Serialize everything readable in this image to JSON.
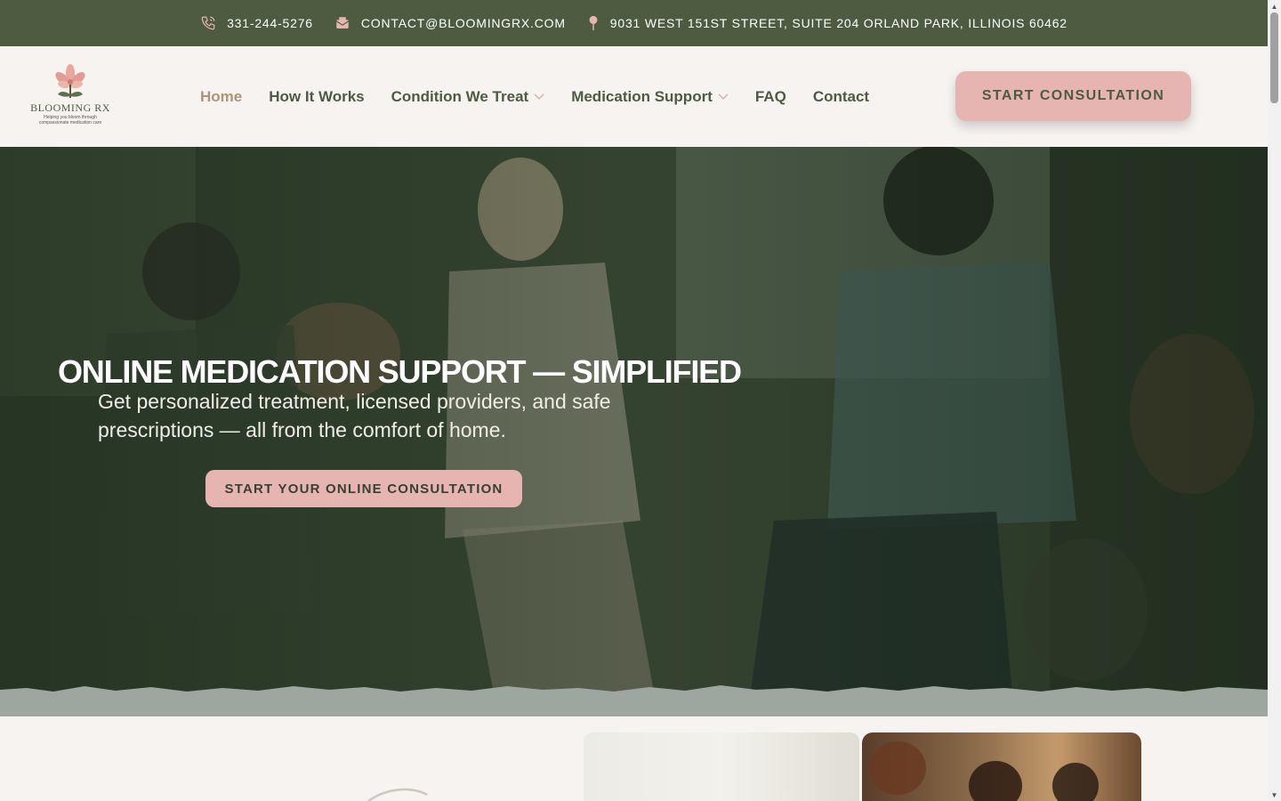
{
  "topbar": {
    "phone": "331-244-5276",
    "email": "CONTACT@BLOOMINGRX.COM",
    "address": "9031 WEST 151ST STREET, SUITE 204 ORLAND PARK, ILLINOIS 60462",
    "icons": [
      "phone-icon",
      "envelope-icon",
      "map-pin-icon"
    ]
  },
  "logo": {
    "name": "BLOOMING RX",
    "tagline_line1": "Helping you bloom through",
    "tagline_line2": "compassionate medication care"
  },
  "nav": {
    "items": [
      {
        "label": "Home",
        "active": true,
        "dropdown": false
      },
      {
        "label": "How It Works",
        "active": false,
        "dropdown": false
      },
      {
        "label": "Condition We Treat",
        "active": false,
        "dropdown": true
      },
      {
        "label": "Medication Support",
        "active": false,
        "dropdown": true
      },
      {
        "label": "FAQ",
        "active": false,
        "dropdown": false
      },
      {
        "label": "Contact",
        "active": false,
        "dropdown": false
      }
    ],
    "cta_label": "START CONSULTATION"
  },
  "hero": {
    "title": "ONLINE MEDICATION SUPPORT — SIMPLIFIED",
    "subtitle": "Get personalized treatment, licensed providers, and safe prescriptions — all from the comfort of home.",
    "button_label": "START YOUR ONLINE CONSULTATION"
  },
  "colors": {
    "brand_green": "#4d5b41",
    "accent_pink": "#e6b5b1",
    "active_nav": "#b09477",
    "page_bg": "#f7f3f1"
  }
}
